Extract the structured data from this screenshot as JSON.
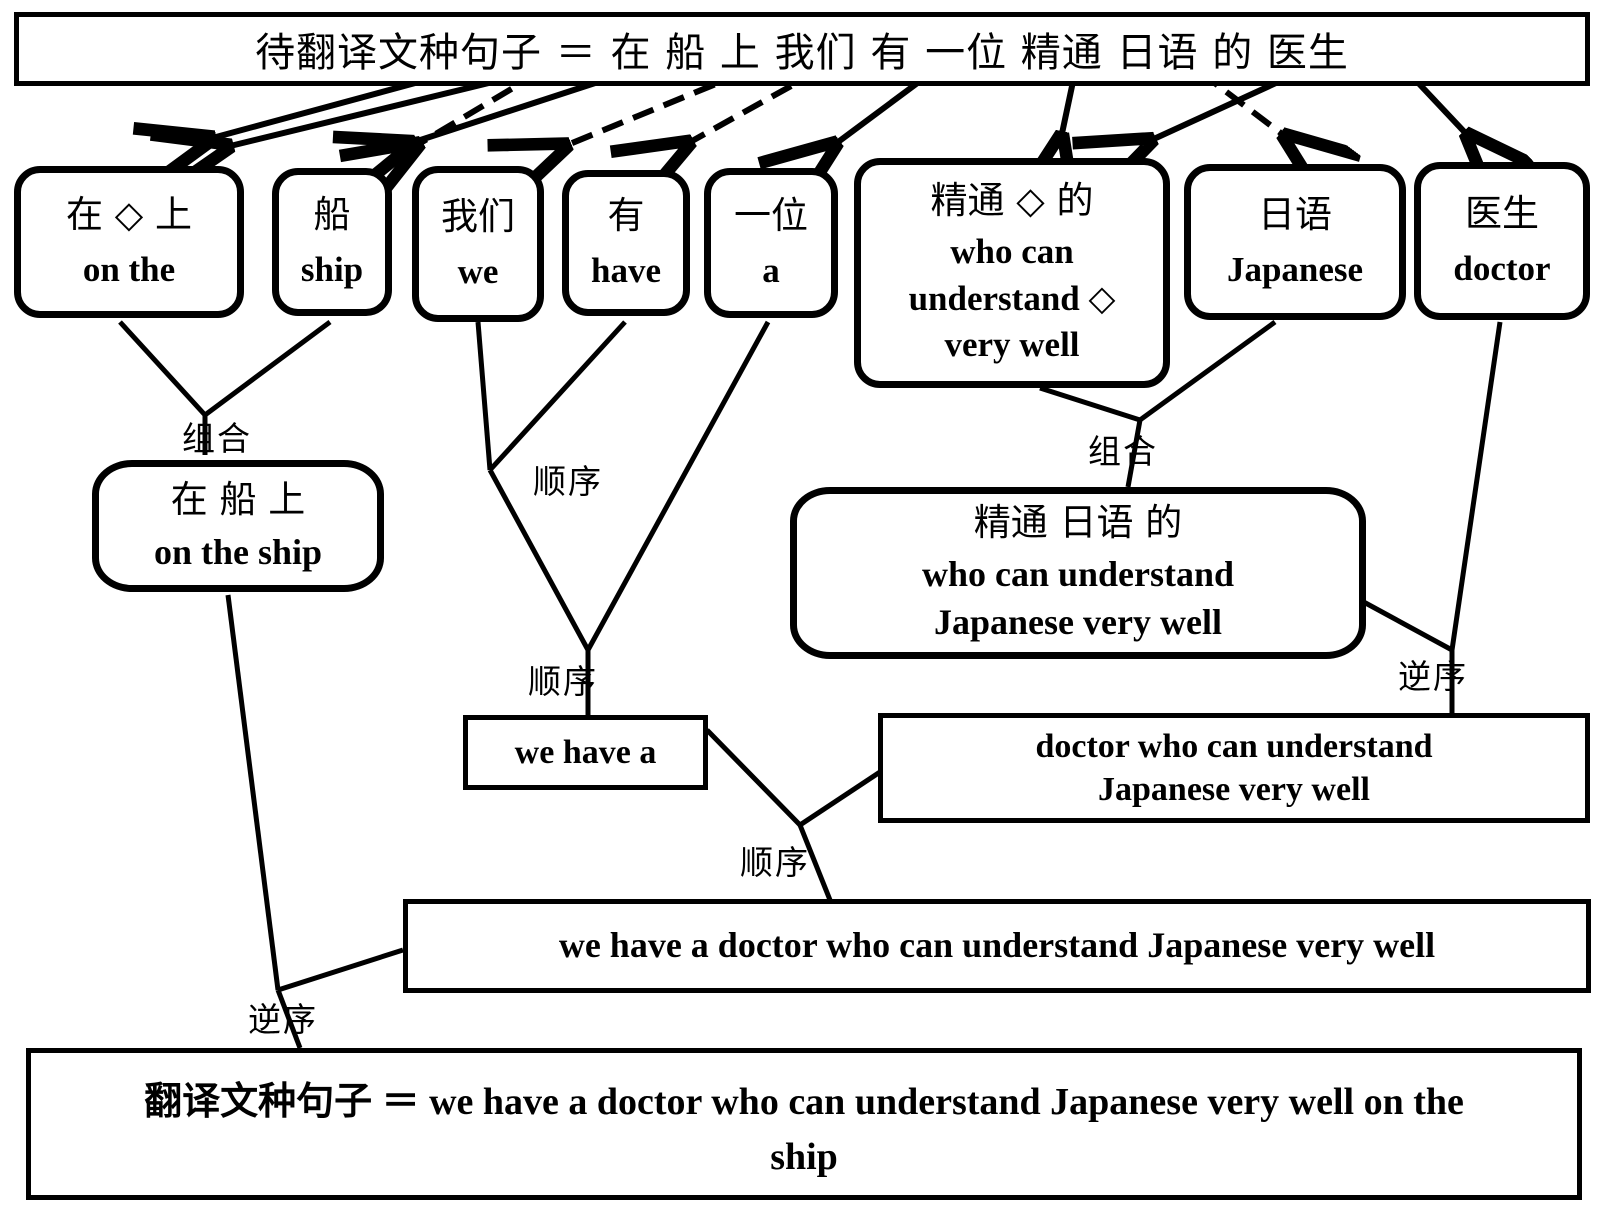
{
  "source_banner": {
    "name": "source-sentence-banner",
    "label_cn": "待翻译文种句子",
    "equals": "＝",
    "tokens": [
      "在",
      "船",
      "上",
      "我们",
      "有",
      "一位",
      "精通",
      "日语",
      "的",
      "医生"
    ],
    "full_text": "待翻译文种句子 ＝ 在 船 上 我们 有 一位 精通 日语 的 医生"
  },
  "result_banner": {
    "name": "target-sentence-banner",
    "label_cn": "翻译文种句子",
    "equals": "＝",
    "line1": "翻译文种句子 ＝ we have a doctor who can understand Japanese very well on the",
    "line2": "ship"
  },
  "lexical_nodes": [
    {
      "id": "n1",
      "cn": "在 ◇ 上",
      "en": "on the"
    },
    {
      "id": "n2",
      "cn": "船",
      "en": "ship"
    },
    {
      "id": "n3",
      "cn": "我们",
      "en": "we"
    },
    {
      "id": "n4",
      "cn": "有",
      "en": "have"
    },
    {
      "id": "n5",
      "cn": "一位",
      "en": "a"
    },
    {
      "id": "n6",
      "cn": "精通 ◇ 的",
      "en_line1": "who can",
      "en_line2": "understand ◇",
      "en_line3": "very well"
    },
    {
      "id": "n7",
      "cn": "日语",
      "en": "Japanese"
    },
    {
      "id": "n8",
      "cn": "医生",
      "en": "doctor"
    }
  ],
  "phrase_nodes": {
    "on_the_ship": {
      "cn": "在 船 上",
      "en": "on the ship"
    },
    "who_can_understand_japanese": {
      "cn": "精通 日语 的",
      "en_line1": "who can understand",
      "en_line2": "Japanese very well"
    },
    "we_have_a": {
      "en": "we have a"
    },
    "doctor_rel": {
      "en_line1": "doctor who can understand",
      "en_line2": "Japanese very well"
    },
    "main_clause": {
      "en": "we have a doctor who can understand Japanese very well"
    }
  },
  "operations": [
    {
      "id": "op1",
      "label": "组合",
      "meaning": "combine"
    },
    {
      "id": "op2",
      "label": "组合",
      "meaning": "combine"
    },
    {
      "id": "op3",
      "label": "顺序",
      "meaning": "sequential-order"
    },
    {
      "id": "op4",
      "label": "顺序",
      "meaning": "sequential-order"
    },
    {
      "id": "op5",
      "label": "逆序",
      "meaning": "reverse-order"
    },
    {
      "id": "op6",
      "label": "顺序",
      "meaning": "sequential-order"
    },
    {
      "id": "op7",
      "label": "逆序",
      "meaning": "reverse-order"
    }
  ],
  "colors": {
    "ink": "#000000",
    "paper": "#ffffff"
  }
}
